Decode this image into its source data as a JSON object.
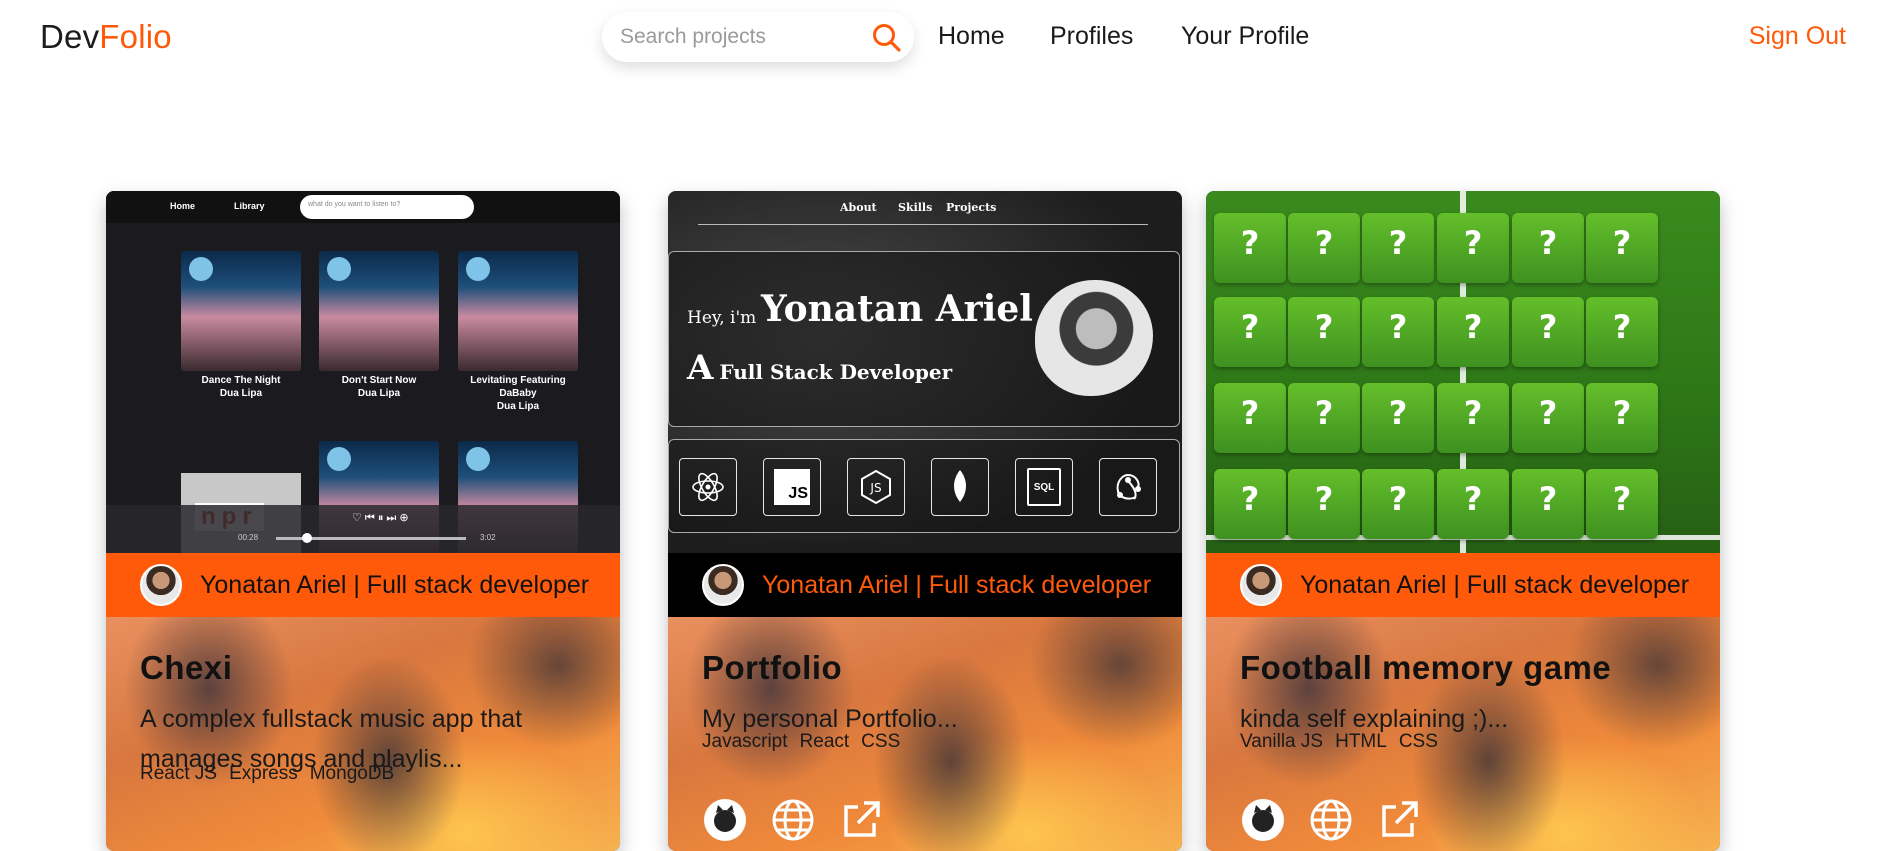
{
  "logo": {
    "part1": "Dev",
    "part2": "Folio"
  },
  "search": {
    "placeholder": "Search projects"
  },
  "nav": {
    "home": "Home",
    "profiles": "Profiles",
    "your_profile": "Your Profile",
    "sign_out": "Sign Out"
  },
  "colors": {
    "accent": "#ff5a0a",
    "author_bar_orange": "#ff5a0a",
    "author_bar_black": "#000000"
  },
  "cards": [
    {
      "author": "Yonatan Ariel | Full stack developer",
      "title": "Chexi",
      "description": "A complex fullstack music app that manages songs and playlis...",
      "tags": [
        "React JS",
        "Express",
        "MongoDB"
      ],
      "screenshot": {
        "nav_home": "Home",
        "nav_library": "Library",
        "search_placeholder": "what do you want to listen to?",
        "songs": [
          {
            "title": "Dance The Night",
            "artist": "Dua Lipa"
          },
          {
            "title": "Don't Start Now",
            "artist": "Dua Lipa"
          },
          {
            "title": "Levitating Featuring DaBaby",
            "artist": "Dua Lipa"
          }
        ],
        "time_start": "00:28",
        "time_end": "3:02",
        "npr_logo": "npr"
      }
    },
    {
      "author": "Yonatan Ariel | Full stack developer",
      "title": "Portfolio",
      "description": "My personal Portfolio...",
      "tags": [
        "Javascript",
        "React",
        "CSS"
      ],
      "screenshot": {
        "nav": [
          "About",
          "Skills",
          "Projects"
        ],
        "greeting": "Hey, i'm",
        "name": "Yonatan Ariel",
        "role_prefix": "A",
        "role": "Full Stack Developer",
        "skill_js": "JS",
        "skill_sql": "SQL"
      }
    },
    {
      "author": "Yonatan Ariel | Full stack developer",
      "title": "Football memory game",
      "description": "kinda self explaining ;)...",
      "tags": [
        "Vanilla JS",
        "HTML",
        "CSS"
      ],
      "screenshot": {
        "tile_symbol": "?"
      }
    }
  ]
}
